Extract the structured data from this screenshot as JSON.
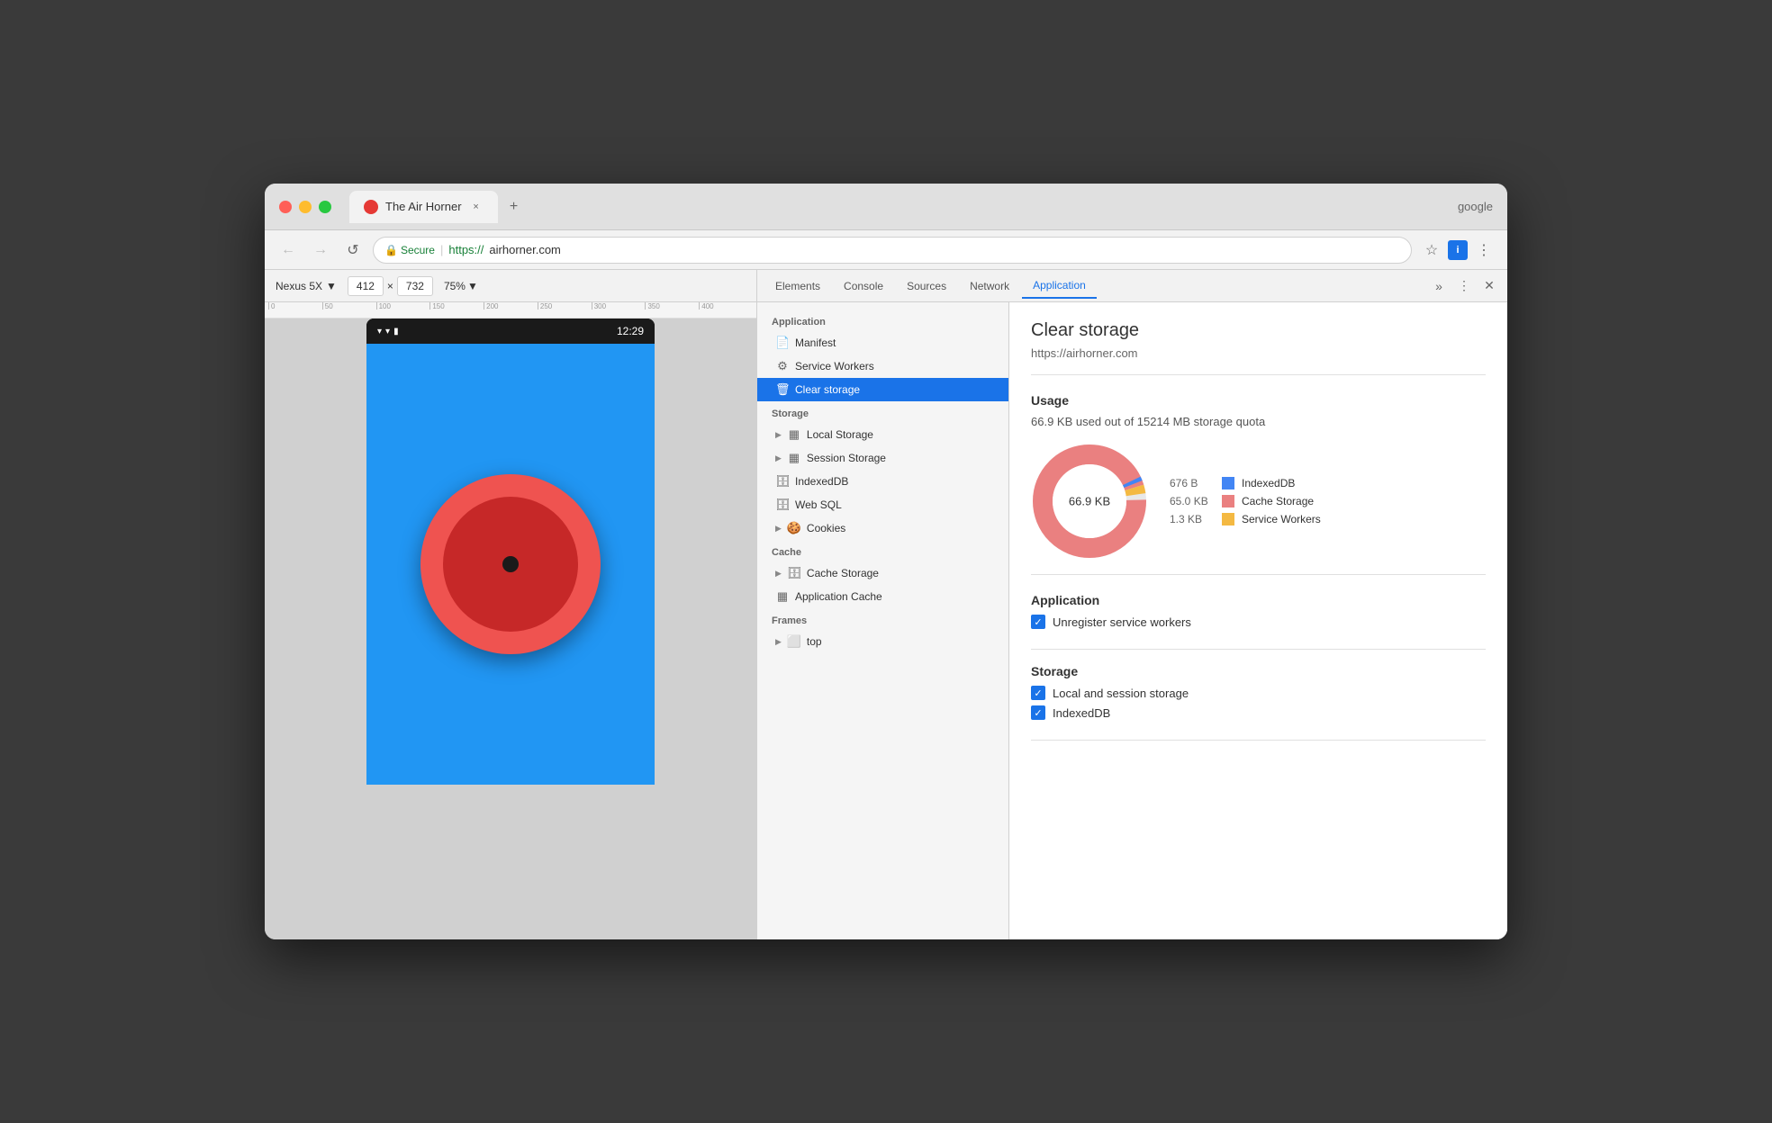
{
  "window": {
    "google_text": "google"
  },
  "title_bar": {
    "tab_title": "The Air Horner",
    "tab_close": "×",
    "new_tab": "+"
  },
  "address_bar": {
    "back": "←",
    "forward": "→",
    "refresh": "↺",
    "secure_label": "Secure",
    "url_https": "https://",
    "url_domain": "airhorner.com"
  },
  "devtools_toolbar": {
    "device": "Nexus 5X",
    "width": "412",
    "x": "×",
    "height": "732",
    "zoom": "75%"
  },
  "devtools_tabs": {
    "elements": "Elements",
    "console": "Console",
    "sources": "Sources",
    "network": "Network",
    "application": "Application"
  },
  "sidebar": {
    "application_section": "Application",
    "manifest": "Manifest",
    "service_workers": "Service Workers",
    "clear_storage": "Clear storage",
    "storage_section": "Storage",
    "local_storage": "Local Storage",
    "session_storage": "Session Storage",
    "indexeddb": "IndexedDB",
    "web_sql": "Web SQL",
    "cookies": "Cookies",
    "cache_section": "Cache",
    "cache_storage": "Cache Storage",
    "application_cache": "Application Cache",
    "frames_section": "Frames",
    "top": "top"
  },
  "main_panel": {
    "title": "Clear storage",
    "url": "https://airhorner.com",
    "usage_section": "Usage",
    "usage_text": "66.9 KB used out of 15214 MB storage quota",
    "donut_center": "66.9 KB",
    "legend": [
      {
        "value": "676 B",
        "label": "IndexedDB",
        "color": "#4285f4"
      },
      {
        "value": "65.0 KB",
        "label": "Cache Storage",
        "color": "#ea8080"
      },
      {
        "value": "1.3 KB",
        "label": "Service Workers",
        "color": "#f4b942"
      }
    ],
    "application_section": "Application",
    "checkbox_service_workers": "Unregister service workers",
    "storage_section": "Storage",
    "checkbox_local_session": "Local and session storage",
    "checkbox_indexeddb": "IndexedDB"
  },
  "phone": {
    "time": "12:29"
  }
}
